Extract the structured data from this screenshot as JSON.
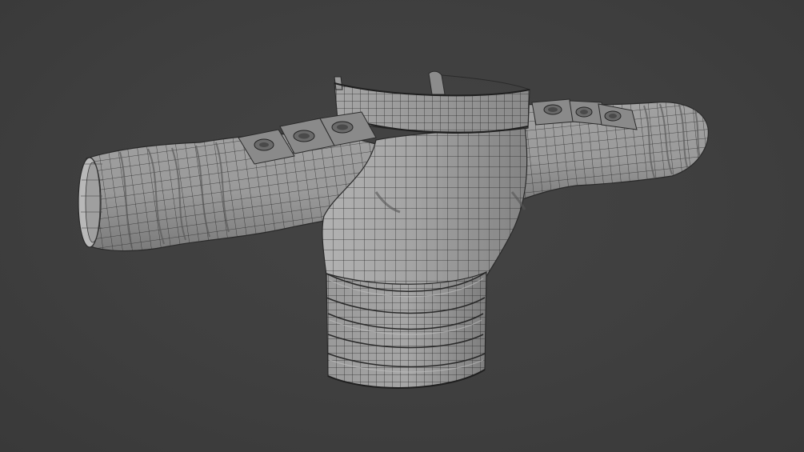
{
  "viewport": {
    "background": "#3d3d3d",
    "mesh_fill": "#8d8d8d",
    "mesh_light": "#a8a8a8",
    "mesh_dark": "#5e5e5e",
    "wire_color": "#2a2a2a",
    "subject": "wireframe-shirt-mesh"
  }
}
